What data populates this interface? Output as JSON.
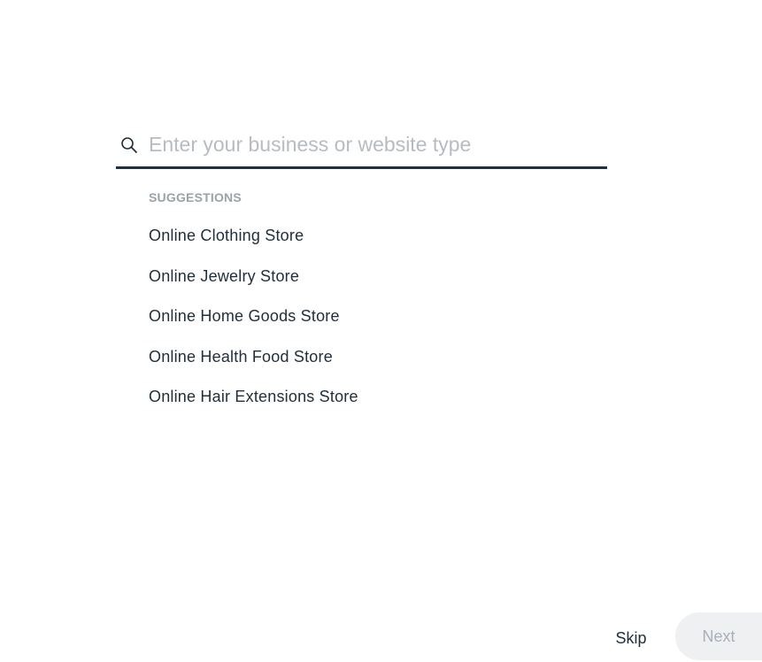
{
  "search": {
    "placeholder": "Enter your business or website type",
    "value": "",
    "icon": "search-icon"
  },
  "suggestions": {
    "title": "SUGGESTIONS",
    "items": [
      {
        "label": "Online Clothing Store"
      },
      {
        "label": "Online Jewelry Store"
      },
      {
        "label": "Online Home Goods Store"
      },
      {
        "label": "Online Health Food Store"
      },
      {
        "label": "Online Hair Extensions Store"
      }
    ]
  },
  "footer": {
    "skip_label": "Skip",
    "next_label": "Next",
    "next_disabled": true
  },
  "colors": {
    "text": "#20303c",
    "placeholder": "#b6bcc2",
    "section_title": "#9aa3ab",
    "next_bg": "#eef0f2",
    "next_text": "#a9b0b7"
  }
}
